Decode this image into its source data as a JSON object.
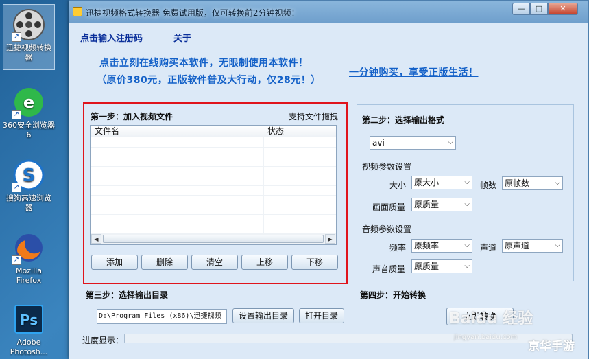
{
  "desktop": {
    "icons": [
      {
        "label": "迅捷视频转换器",
        "icon": "film-reel-icon"
      },
      {
        "label": "360安全浏览器6",
        "icon": "360-browser-icon"
      },
      {
        "label": "搜狗高速浏览器",
        "icon": "sogou-browser-icon"
      },
      {
        "label": "Mozilla Firefox",
        "icon": "firefox-icon"
      },
      {
        "label": "Adobe Photosh...",
        "icon": "photoshop-icon"
      }
    ]
  },
  "window": {
    "title": "迅捷视频格式转换器  免费试用版，仅可转换前2分钟视频！",
    "controls": {
      "min": "—",
      "max": "□",
      "close": "✕"
    }
  },
  "top_links": {
    "register": "点击输入注册码",
    "about": "关于"
  },
  "promo": {
    "line1": "点击立刻在线购买本软件，无限制使用本软件！",
    "line2": "（原价380元，正版软件普及大行动，仅28元！）",
    "right": "一分钟购买，享受正版生活！"
  },
  "step1": {
    "title": "第一步：加入视频文件",
    "drag_hint": "支持文件拖拽",
    "columns": [
      "文件名",
      "状态"
    ],
    "buttons": {
      "add": "添加",
      "delete": "删除",
      "clear": "清空",
      "up": "上移",
      "down": "下移"
    }
  },
  "step2": {
    "title": "第二步：选择输出格式",
    "format": "avi",
    "video_section": "视频参数设置",
    "size_label": "大小",
    "size_value": "原大小",
    "fps_label": "帧数",
    "fps_value": "原帧数",
    "video_quality_label": "画面质量",
    "video_quality_value": "原质量",
    "audio_section": "音频参数设置",
    "freq_label": "频率",
    "freq_value": "原频率",
    "channel_label": "声道",
    "channel_value": "原声道",
    "audio_quality_label": "声音质量",
    "audio_quality_value": "原质量"
  },
  "step3": {
    "title": "第三步：选择输出目录",
    "path": "D:\\Program Files (x86)\\迅捷视频",
    "set_button": "设置输出目录",
    "open_button": "打开目录"
  },
  "step4": {
    "title": "第四步：开始转换",
    "start_button": "立即转换"
  },
  "progress": {
    "label": "进度显示：",
    "value": 0
  },
  "watermarks": {
    "baidu": "Baidu 经验",
    "baidu_url": "jingyan.baidu.com",
    "site": "京华手游"
  },
  "colors": {
    "highlight_border": "#e0141c",
    "link": "#1461c8"
  }
}
